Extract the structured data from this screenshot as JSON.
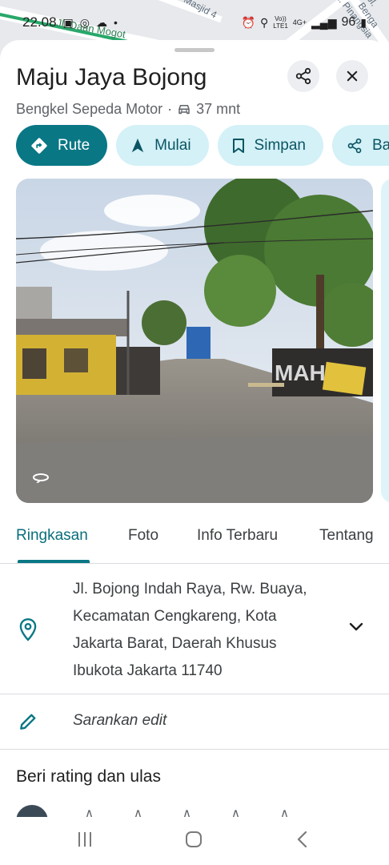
{
  "status_bar": {
    "time": "22.08",
    "battery": "96",
    "network": "4G+",
    "network_sub": "LTE1",
    "volte": "Vo))"
  },
  "map": {
    "label_1": "Jl. Daan Mogot",
    "label_2": "Masjid 4",
    "label_3": "Jl. Pinangsia",
    "label_4": "Jl. Benga"
  },
  "place": {
    "title": "Maju Jaya Bojong",
    "category": "Bengkel Sepeda Motor",
    "separator": "·",
    "drive_time": "37 mnt"
  },
  "actions": {
    "route_label": "Rute",
    "start_label": "Mulai",
    "save_label": "Simpan",
    "share_label": "Ba"
  },
  "tabs": [
    {
      "label": "Ringkasan"
    },
    {
      "label": "Foto"
    },
    {
      "label": "Info Terbaru"
    },
    {
      "label": "Tentang"
    }
  ],
  "address": {
    "line_1": "Jl. Bojong Indah Raya, Rw. Buaya,",
    "line_2": "Kecamatan Cengkareng, Kota",
    "line_3": "Jakarta Barat, Daerah Khusus",
    "line_4": "Ibukota Jakarta 11740"
  },
  "suggest_edit": "Sarankan edit",
  "rating": {
    "title": "Beri rating dan ulas",
    "stars": 5
  },
  "photo": {
    "sign_text": "MAH"
  },
  "colors": {
    "accent": "#0a7785",
    "chip_bg": "#d3f1f7",
    "chip_text": "#0b5563"
  }
}
